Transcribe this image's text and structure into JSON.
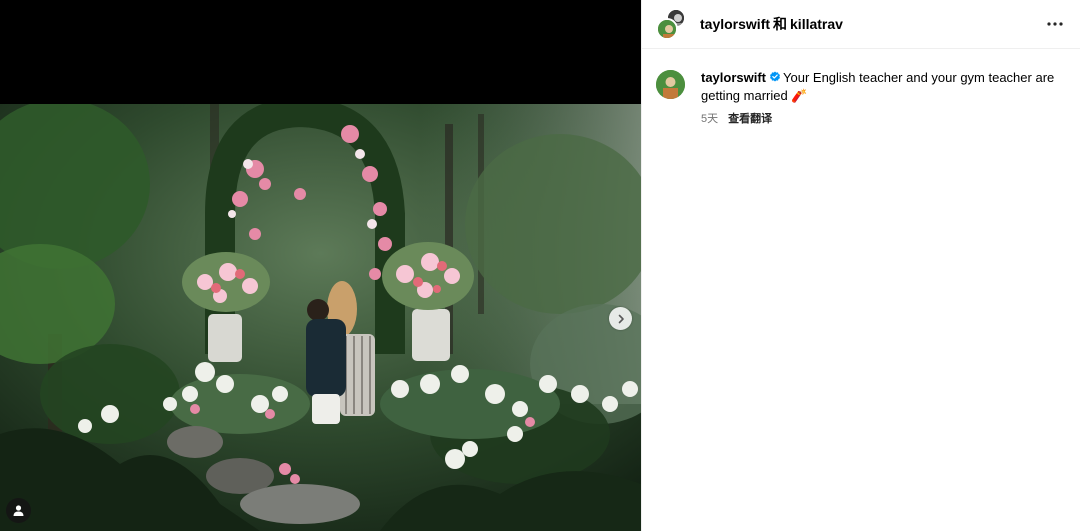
{
  "header": {
    "user_primary": "taylorswift",
    "conjunction": "和",
    "user_collab": "killatrav",
    "more_icon": "more-horizontal-icon"
  },
  "caption": {
    "username": "taylorswift",
    "verified_icon": "verified-badge-icon",
    "text": "Your English teacher and your gym teacher are getting married",
    "emoji": "🧨",
    "age": "5天",
    "translate_label": "查看翻译"
  },
  "media": {
    "next_icon": "chevron-right-icon",
    "tag_icon": "user-tag-icon"
  },
  "colors": {
    "verified": "#0095f6",
    "meta_text": "#737373",
    "divider": "#efefef",
    "avatar_green": "#4c8f3e"
  }
}
